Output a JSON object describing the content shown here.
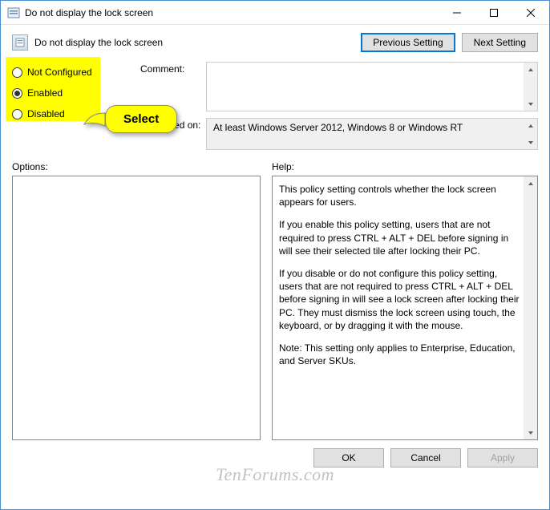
{
  "window": {
    "title": "Do not display the lock screen"
  },
  "header": {
    "title": "Do not display the lock screen",
    "prev_btn": "Previous Setting",
    "next_btn": "Next Setting"
  },
  "radios": {
    "not_configured": "Not Configured",
    "enabled": "Enabled",
    "disabled": "Disabled",
    "selected": "enabled"
  },
  "callout": {
    "label": "Select"
  },
  "comment": {
    "label": "Comment:",
    "value": ""
  },
  "supported": {
    "label": "Supported on:",
    "value": "At least Windows Server 2012, Windows 8 or Windows RT"
  },
  "sections": {
    "options_label": "Options:",
    "help_label": "Help:"
  },
  "help": {
    "p1": "This policy setting controls whether the lock screen appears for users.",
    "p2": "If you enable this policy setting, users that are not required to press CTRL + ALT + DEL before signing in will see their selected tile after locking their PC.",
    "p3": "If you disable or do not configure this policy setting, users that are not required to press CTRL + ALT + DEL before signing in will see a lock screen after locking their PC. They must dismiss the lock screen using touch, the keyboard, or by dragging it with the mouse.",
    "p4": "Note: This setting only applies to Enterprise, Education, and Server SKUs."
  },
  "footer": {
    "ok": "OK",
    "cancel": "Cancel",
    "apply": "Apply"
  },
  "watermark": "TenForums.com"
}
